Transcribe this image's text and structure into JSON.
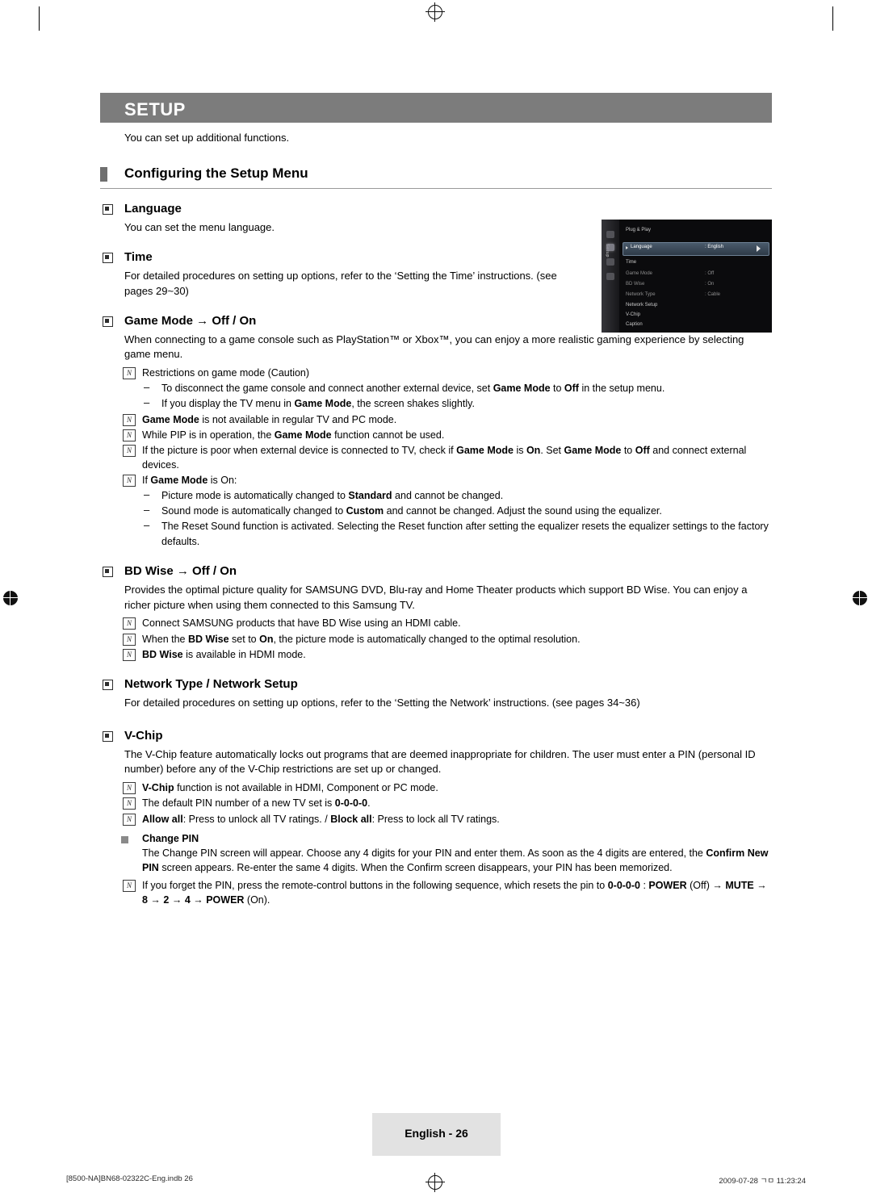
{
  "header": {
    "title": "SETUP",
    "intro": "You can set up additional functions.",
    "section_title": "Configuring the Setup Menu"
  },
  "sections": {
    "language": {
      "heading": "Language",
      "body": "You can set the menu language."
    },
    "time": {
      "heading": "Time",
      "body": "For detailed procedures on setting up options, refer to the ‘Setting the Time’ instructions. (see pages 29~30)"
    },
    "game_mode": {
      "heading": "Game Mode → Off / On",
      "body": "When connecting to a game console such as PlayStation™ or Xbox™, you can enjoy a more realistic gaming experience by selecting game menu.",
      "note1": "Restrictions on game mode (Caution)",
      "dash1": "To disconnect the game console and connect another external device, set <b>Game Mode</b> to <b>Off</b> in the setup menu.",
      "dash2": "If you display the TV menu in <b>Game Mode</b>, the screen shakes slightly.",
      "note2": "<b>Game Mode</b> is not available in regular TV and PC mode.",
      "note3": "While PIP is in operation, the <b>Game Mode</b> function cannot be used.",
      "note4": "If the picture is poor when external device is connected to TV, check if <b>Game Mode</b> is <b>On</b>. Set <b>Game Mode</b> to <b>Off</b> and connect external devices.",
      "note5": "If <b>Game Mode</b> is On:",
      "dash3": "Picture mode is automatically changed to <b>Standard</b> and cannot be changed.",
      "dash4": "Sound mode is automatically changed to <b>Custom</b> and cannot be changed. Adjust the sound using the equalizer.",
      "dash5": "The Reset Sound function is activated. Selecting the Reset function after setting the equalizer resets the equalizer settings to the factory defaults."
    },
    "bd_wise": {
      "heading": "BD Wise → Off / On",
      "body": "Provides the optimal picture quality for SAMSUNG DVD, Blu-ray and Home Theater products which support BD Wise. You can enjoy a richer picture when using them connected to this Samsung TV.",
      "note1": "Connect SAMSUNG products that have BD Wise using an HDMI cable.",
      "note2": "When the <b>BD Wise</b> set to <b>On</b>, the picture mode is automatically changed to the optimal resolution.",
      "note3": "<b>BD Wise</b> is available in HDMI mode."
    },
    "network": {
      "heading": "Network Type / Network Setup",
      "body": "For detailed procedures on setting up options, refer to the ‘Setting the Network’ instructions. (see pages 34~36)"
    },
    "vchip": {
      "heading": "V-Chip",
      "body": "The V-Chip feature automatically locks out programs that are deemed inappropriate for children. The user must enter a PIN (personal ID number) before any of the V-Chip restrictions are set up or changed.",
      "note1": "<b>V-Chip</b> function is not available in HDMI, Component or PC mode.",
      "note2": "The default PIN number of a new TV set is <b>0-0-0-0</b>.",
      "note3": "<b>Allow all</b>: Press to unlock all TV ratings. / <b>Block all</b>: Press to lock all TV ratings.",
      "change_pin_heading": "Change PIN",
      "change_pin_body": "The Change PIN screen will appear. Choose any 4 digits for your PIN and enter them. As soon as the 4 digits are entered, the <b>Confirm New PIN</b> screen appears. Re-enter the same 4 digits. When the Confirm screen disappears, your PIN has been memorized.",
      "note4": "If you forget the PIN, press the remote-control buttons in the following sequence, which resets the pin to <b>0-0-0-0</b> : <b>POWER</b> (Off) → <b>MUTE</b> → <b>8</b> → <b>2</b> → <b>4</b> → <b>POWER</b> (On)."
    }
  },
  "tv_menu": {
    "rail_label": "Setup",
    "items": [
      {
        "label": "Plug & Play",
        "value": ""
      },
      {
        "label": "Language",
        "value": ": English"
      },
      {
        "label": "Time",
        "value": ""
      },
      {
        "label": "Game Mode",
        "value": ": Off"
      },
      {
        "label": "BD Wise",
        "value": ": On"
      },
      {
        "label": "Network Type",
        "value": ": Cable"
      },
      {
        "label": "Network Setup",
        "value": ""
      },
      {
        "label": "V-Chip",
        "value": ""
      },
      {
        "label": "Caption",
        "value": ""
      }
    ]
  },
  "footer": {
    "page_label": "English - 26",
    "left": "[8500-NA]BN68-02322C-Eng.indb   26",
    "right": "2009-07-28   ㄱㅁ 11:23:24"
  }
}
